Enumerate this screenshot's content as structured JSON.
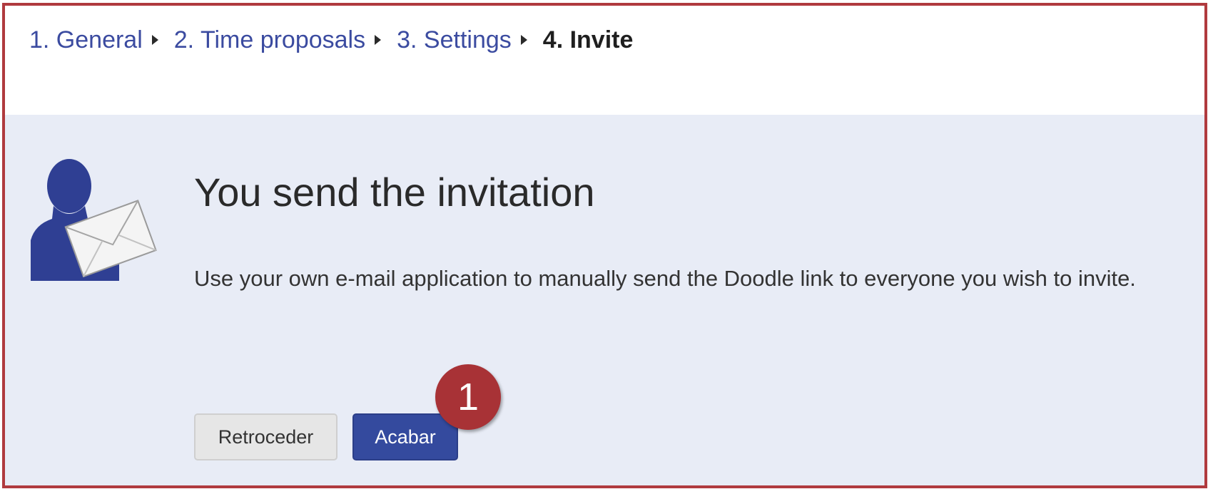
{
  "breadcrumb": {
    "steps": [
      {
        "label": "1. General"
      },
      {
        "label": "2. Time proposals"
      },
      {
        "label": "3. Settings"
      },
      {
        "label": "4. Invite"
      }
    ]
  },
  "main": {
    "title": "You send the invitation",
    "description": "Use your own e-mail application to manually send the Doodle link to everyone you wish to invite.",
    "back_button": "Retroceder",
    "finish_button": "Acabar",
    "annotation_badge": "1"
  },
  "icons": {
    "invite": "person-with-envelope-icon",
    "breadcrumb_separator": "triangle-right-icon"
  },
  "colors": {
    "link": "#3b4ba0",
    "primary_button": "#344a9e",
    "panel_background": "#e8ecf6",
    "annotation_border": "#b03a3e",
    "badge": "#a83236"
  }
}
